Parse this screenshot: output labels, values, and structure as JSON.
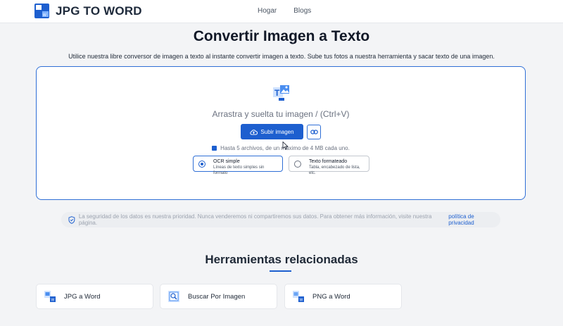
{
  "header": {
    "logo_text": "JPG TO WORD",
    "nav": [
      "Hogar",
      "Blogs"
    ]
  },
  "main": {
    "title": "Convertir Imagen a Texto",
    "subtitle": "Utilice nuestra libre conversor de imagen a texto al instante convertir imagen a texto. Sube tus fotos a nuestra herramienta y sacar texto de una imagen."
  },
  "upload": {
    "drop_text": "Arrastra y suelta tu imagen / (Ctrl+V)",
    "button_label": "Subir imagen",
    "limit_text": "Hasta 5 archivos, de un máximo de 4 MB cada uno.",
    "options": [
      {
        "title": "OCR simple",
        "desc": "Líneas de texto simples sin formato",
        "selected": true
      },
      {
        "title": "Texto formateado",
        "desc": "Tabla, encabezado de lista, etc.",
        "selected": false
      }
    ]
  },
  "privacy": {
    "text": "La seguridad de los datos es nuestra prioridad. Nunca venderemos ni compartiremos sus datos. Para obtener más información, visite nuestra página.",
    "link": "política de privacidad"
  },
  "related": {
    "title": "Herramientas relacionadas",
    "tools": [
      "JPG a Word",
      "Buscar Por Imagen",
      "PNG a Word"
    ]
  },
  "colors": {
    "accent": "#1d5fcf",
    "background": "#f3f4f6"
  }
}
